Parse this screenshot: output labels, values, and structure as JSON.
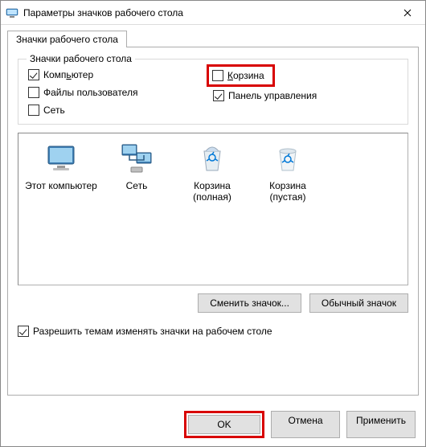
{
  "window": {
    "title": "Параметры значков рабочего стола"
  },
  "tab": {
    "label": "Значки рабочего стола"
  },
  "group": {
    "title": "Значки рабочего стола"
  },
  "checks": {
    "computer": "Компьютер",
    "recyclebin": "Корзина",
    "userfiles": "Файлы пользователя",
    "controlpanel": "Панель управления",
    "network": "Сеть"
  },
  "icons": {
    "thispc": "Этот компьютер",
    "network": "Сеть",
    "bin_full": "Корзина (полная)",
    "bin_empty": "Корзина (пустая)"
  },
  "buttons": {
    "change_icon": "Сменить значок...",
    "default_icon": "Обычный значок",
    "ok": "OK",
    "cancel": "Отмена",
    "apply": "Применить"
  },
  "allow_themes": "Разрешить темам изменять значки на рабочем столе"
}
